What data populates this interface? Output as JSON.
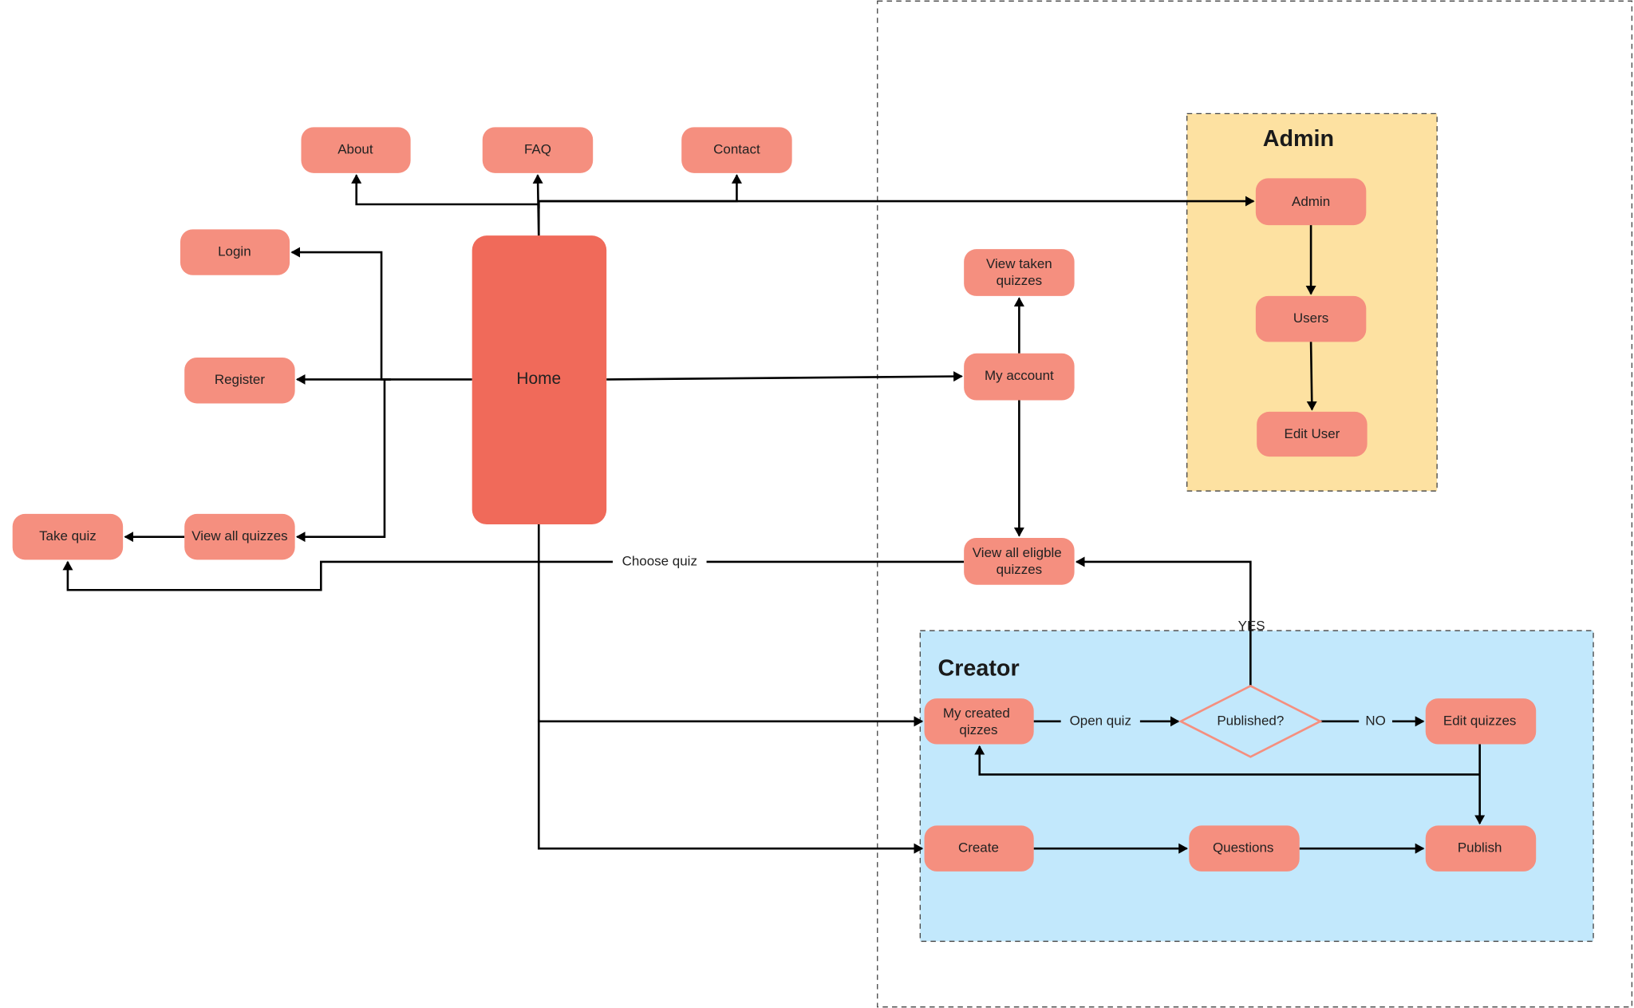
{
  "colors": {
    "node": "#f58f7f",
    "home": "#f06a5a",
    "admin_bg": "#fde1a1",
    "creator_bg": "#c2e8fc",
    "decision_stroke": "#f58f7f"
  },
  "nodes": {
    "about": "About",
    "faq": "FAQ",
    "contact": "Contact",
    "login": "Login",
    "register": "Register",
    "view_all_quizzes": "View all quizzes",
    "take_quiz": "Take quiz",
    "home": "Home",
    "view_taken_1": "View taken",
    "view_taken_2": "quizzes",
    "my_account": "My account",
    "eligible_1": "View all eligble",
    "eligible_2": "quizzes",
    "admin": "Admin",
    "users": "Users",
    "edit_user": "Edit User",
    "my_created_1": "My created",
    "my_created_2": "qizzes",
    "published": "Published?",
    "edit_quizzes": "Edit quizzes",
    "create": "Create",
    "questions": "Questions",
    "publish": "Publish"
  },
  "groups": {
    "admin": "Admin",
    "creator": "Creator"
  },
  "edge_labels": {
    "choose_quiz": "Choose quiz",
    "yes": "YES",
    "open_quiz": "Open quiz",
    "no": "NO"
  }
}
